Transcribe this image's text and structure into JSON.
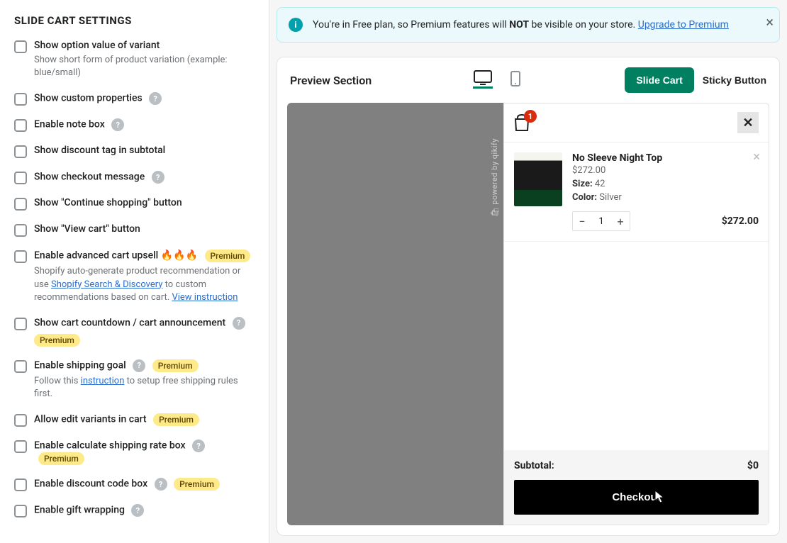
{
  "panel": {
    "title": "SLIDE CART SETTINGS",
    "premium_label": "Premium"
  },
  "settings": {
    "variant_option": {
      "label": "Show option value of variant",
      "desc": "Show short form of product variation (example: blue/small)"
    },
    "custom_props": {
      "label": "Show custom properties"
    },
    "note_box": {
      "label": "Enable note box"
    },
    "discount_tag": {
      "label": "Show discount tag in subtotal"
    },
    "checkout_msg": {
      "label": "Show checkout message"
    },
    "continue_shop": {
      "label": "Show \"Continue shopping\" button"
    },
    "view_cart": {
      "label": "Show \"View cart\" button"
    },
    "upsell": {
      "label": "Enable advanced cart upsell",
      "desc_1": "Shopify auto-generate product recommendation or use ",
      "link_1": "Shopify Search & Discovery",
      "desc_2": " to custom recommendations based on cart. ",
      "link_2": "View instruction"
    },
    "countdown": {
      "label": "Show cart countdown / cart announcement"
    },
    "shipping_goal": {
      "label": "Enable shipping goal",
      "desc_1": "Follow this ",
      "link": "instruction",
      "desc_2": " to setup free shipping rules first."
    },
    "edit_variants": {
      "label": "Allow edit variants in cart"
    },
    "calc_shipping": {
      "label": "Enable calculate shipping rate box"
    },
    "discount_code": {
      "label": "Enable discount code box"
    },
    "gift_wrap": {
      "label": "Enable gift wrapping"
    }
  },
  "banner": {
    "text_1": "You're in Free plan, so Premium features will ",
    "bold": "NOT",
    "text_2": " be visible on your store.  ",
    "link": "Upgrade to Premium"
  },
  "preview": {
    "title": "Preview Section",
    "slide_btn": "Slide Cart",
    "sticky_btn": "Sticky Button",
    "powered": "powered by qikify"
  },
  "cart": {
    "badge": "1",
    "item": {
      "title": "No Sleeve Night Top",
      "price": "$272.00",
      "size_label": "Size:",
      "size_value": "42",
      "color_label": "Color:",
      "color_value": "Silver",
      "qty": "1",
      "line_price": "$272.00"
    },
    "subtotal_label": "Subtotal:",
    "subtotal_value": "$0",
    "checkout": "Checkout"
  }
}
